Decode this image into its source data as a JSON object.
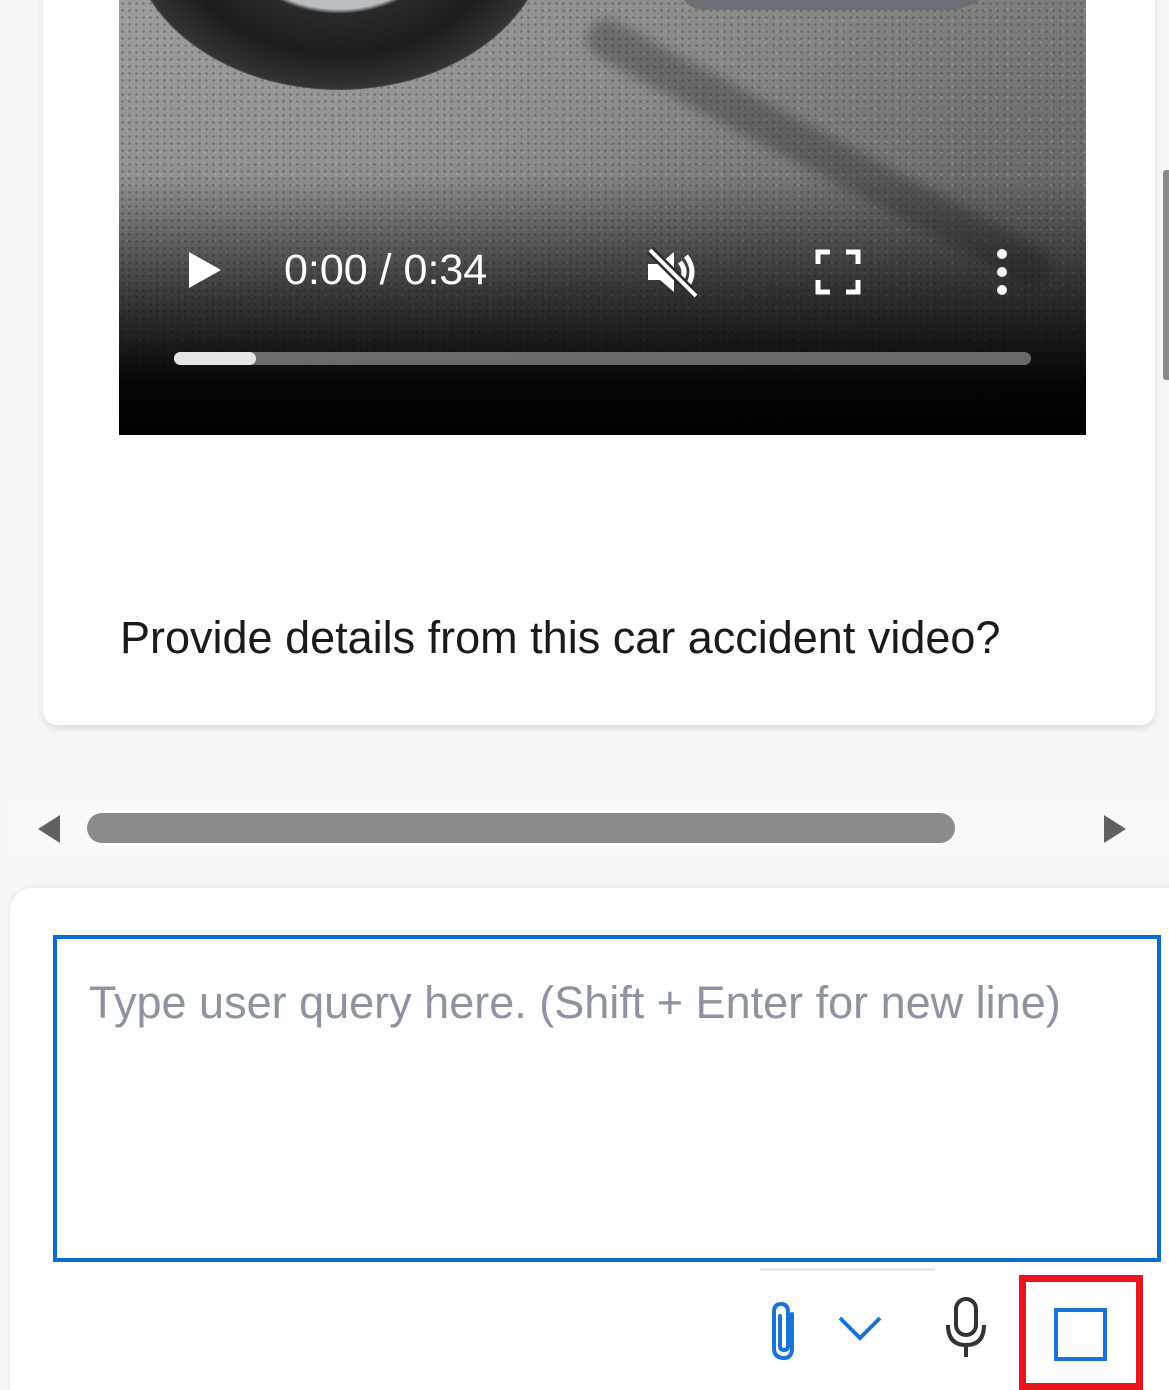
{
  "message": {
    "video": {
      "time_display": "0:00 / 0:34",
      "progress": 0.096,
      "icons": {
        "play": "play-icon",
        "mute": "volume-muted-icon",
        "fullscreen": "fullscreen-icon",
        "more": "more-vertical-icon"
      }
    },
    "text": "Provide details from this car accident video?"
  },
  "composer": {
    "placeholder": "Type user query here. (Shift + Enter for new line)",
    "value": "",
    "accent_color": "#0a6fd1",
    "highlight_color": "#e8141f",
    "icons": {
      "attach": "paperclip-icon",
      "attach_menu": "chevron-down-icon",
      "mic": "microphone-icon",
      "stop": "stop-square-icon"
    }
  }
}
